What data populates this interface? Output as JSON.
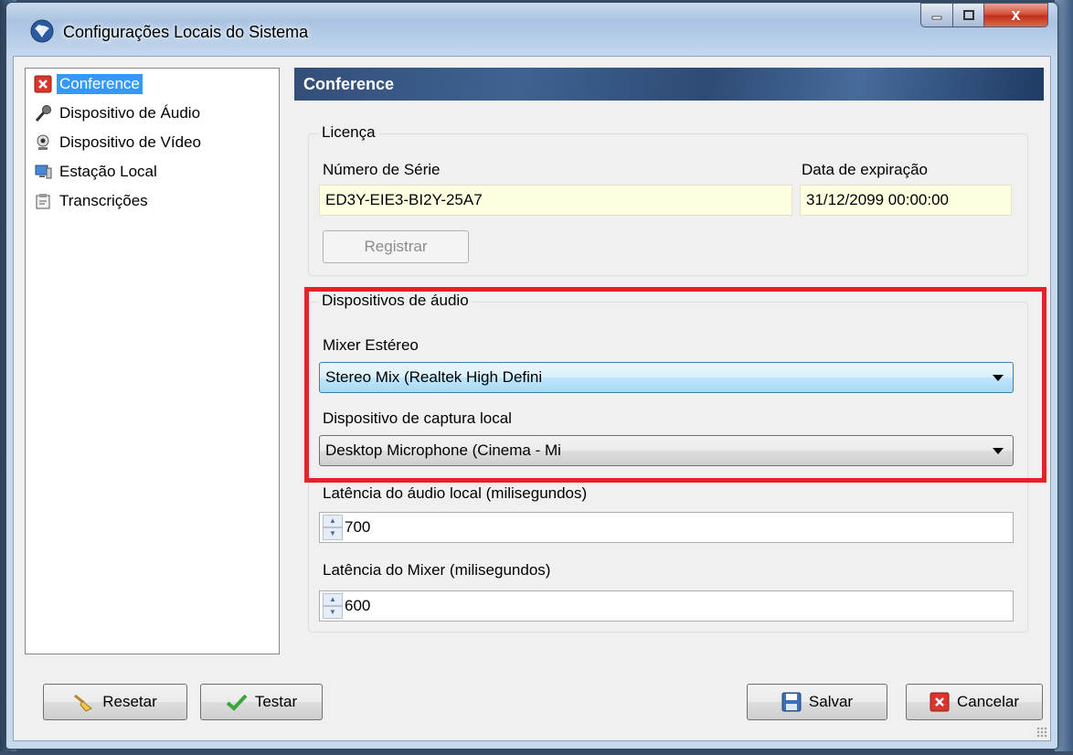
{
  "window": {
    "title": "Configurações Locais do Sistema",
    "close_glyph": "x"
  },
  "sidebar": {
    "items": [
      {
        "label": "Conference",
        "icon": "close-x-icon",
        "selected": true
      },
      {
        "label": "Dispositivo de Áudio",
        "icon": "microphone-icon"
      },
      {
        "label": "Dispositivo de Vídeo",
        "icon": "webcam-icon"
      },
      {
        "label": "Estação Local",
        "icon": "computer-icon"
      },
      {
        "label": "Transcrições",
        "icon": "transcription-icon"
      }
    ]
  },
  "panel": {
    "title": "Conference",
    "license": {
      "legend": "Licença",
      "serial_label": "Número de Série",
      "serial_value": "ED3Y-EIE3-BI2Y-25A7",
      "expiry_label": "Data de expiração",
      "expiry_value": "31/12/2099 00:00:00",
      "register_button": "Registrar"
    },
    "audio": {
      "legend": "Dispositivos de áudio",
      "mixer_label": "Mixer Estéreo",
      "mixer_value": "Stereo Mix (Realtek High Defini",
      "capture_label": "Dispositivo de captura local",
      "capture_value": "Desktop Microphone (Cinema - Mi",
      "local_latency_label": "Latência do áudio local (milisegundos)",
      "local_latency_value": "700",
      "mixer_latency_label": "Latência do Mixer (milisegundos)",
      "mixer_latency_value": "600"
    }
  },
  "footer": {
    "reset_button": "Resetar",
    "test_button": "Testar",
    "save_button": "Salvar",
    "cancel_button": "Cancelar"
  },
  "colors": {
    "highlight": "#e8202a",
    "selection": "#3399ff",
    "header_bg": "#334f78"
  }
}
